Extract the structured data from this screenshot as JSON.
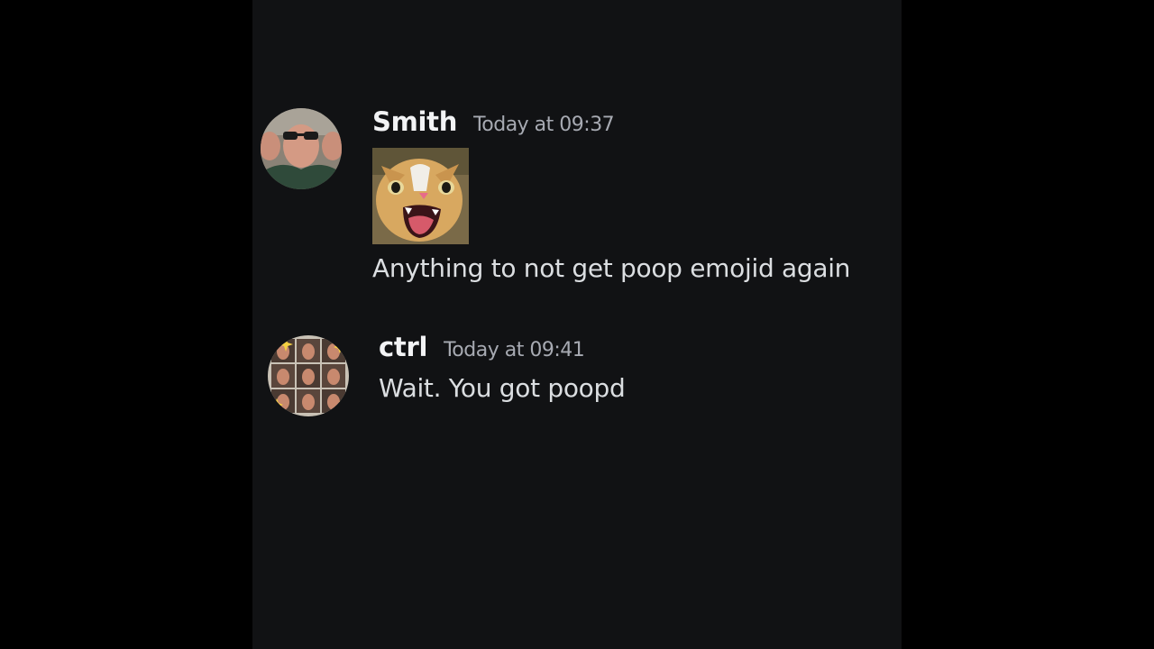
{
  "messages": [
    {
      "username": "Smith",
      "timestamp": "Today at 09:37",
      "attachment": "cat-image",
      "text": "Anything to not get poop emojid again"
    },
    {
      "username": "ctrl",
      "timestamp": "Today at 09:41",
      "text": "Wait. You got poopd"
    }
  ],
  "colors": {
    "background": "#111214",
    "username": "#f2f3f5",
    "timestamp": "#a7aab2",
    "text": "#dbdee1"
  }
}
